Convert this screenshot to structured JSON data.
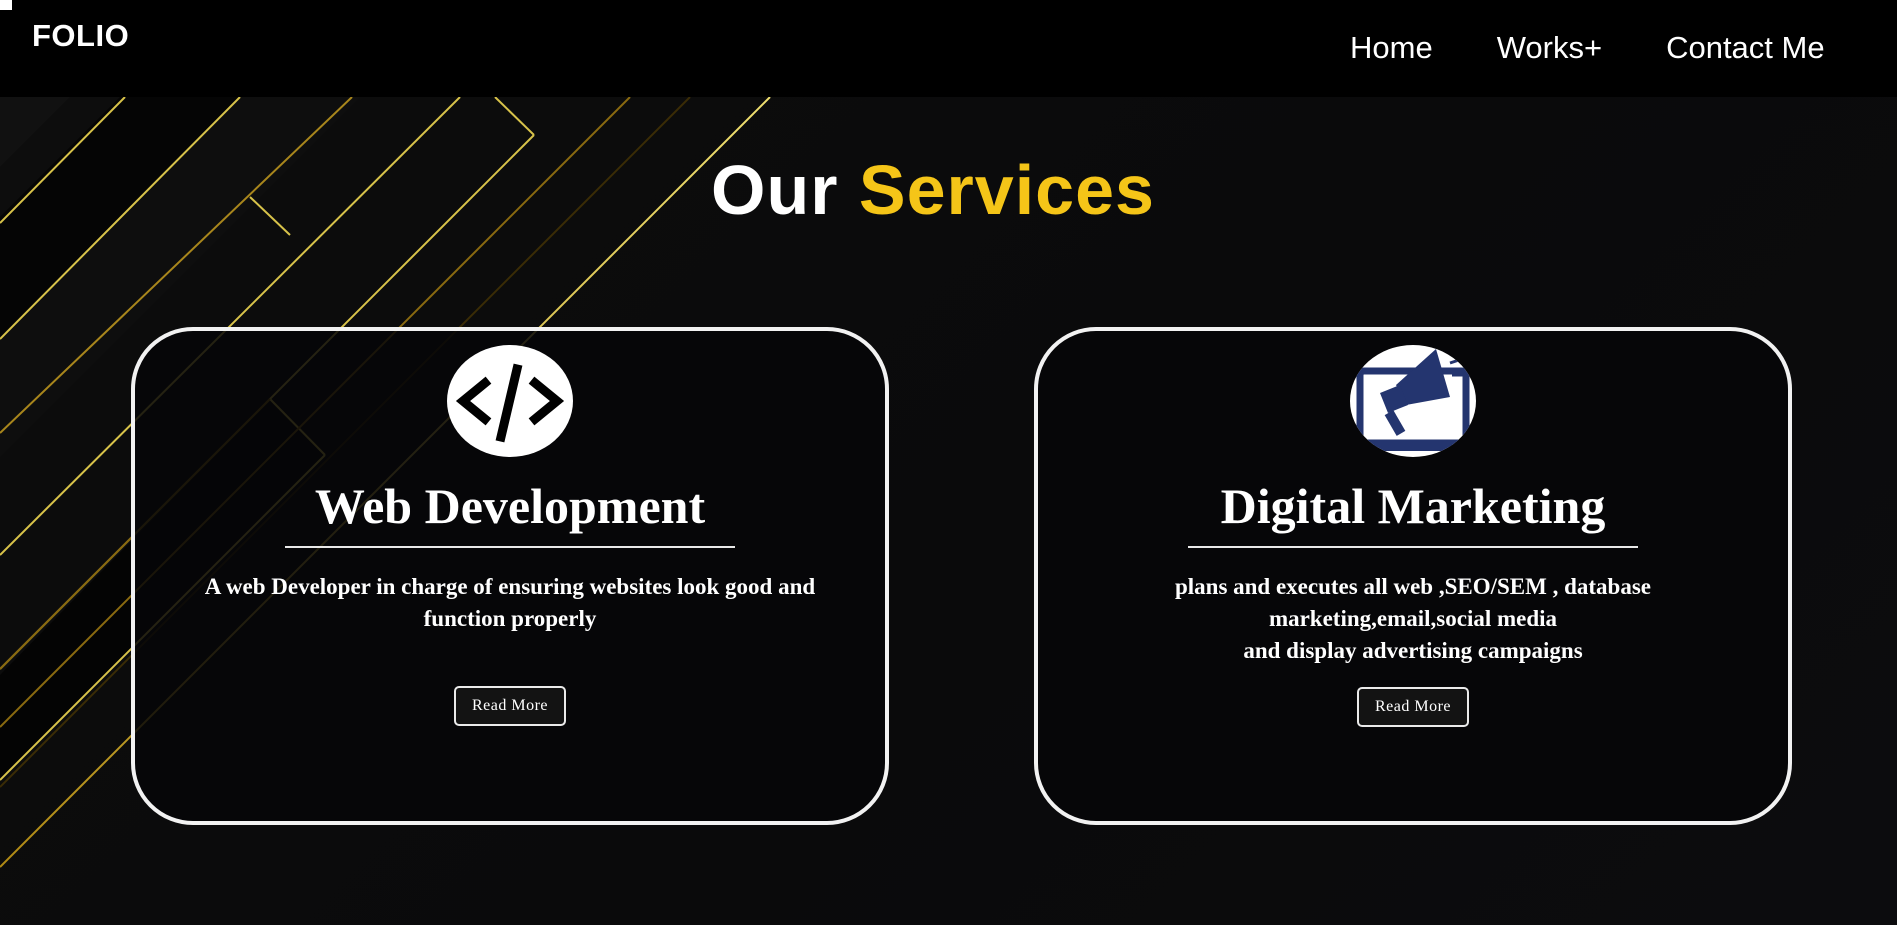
{
  "header": {
    "logo": "FOLIO",
    "nav": [
      {
        "label": "Home"
      },
      {
        "label": "Works+"
      },
      {
        "label": "Contact Me"
      }
    ]
  },
  "services": {
    "title_prefix": "Our",
    "title_accent": "Services",
    "accent_color": "#f5c518",
    "cards": [
      {
        "title": "Web Development",
        "icon": "code-icon",
        "icon_text": "</>",
        "description_lines": [
          "A web Developer in charge of ensuring websites look good and function properly"
        ],
        "button_label": "Read More"
      },
      {
        "title": "Digital Marketing",
        "icon": "megaphone-icon",
        "description_lines": [
          "plans and executes all web ,SEO/SEM , database marketing,email,social media",
          "and display advertising campaigns"
        ],
        "button_label": "Read More"
      }
    ]
  }
}
